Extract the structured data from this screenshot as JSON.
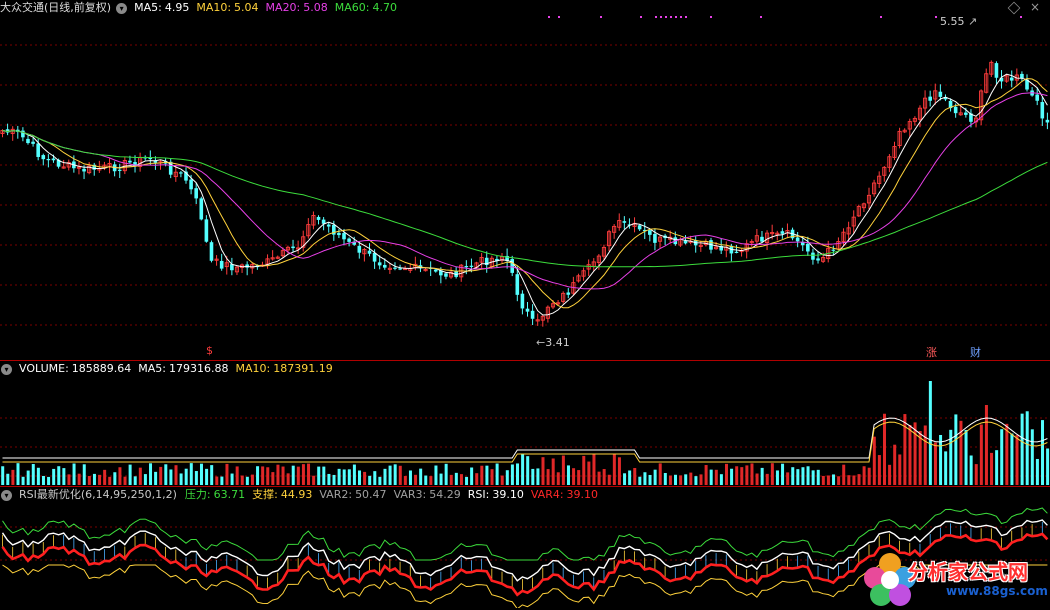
{
  "main_panel": {
    "title": "大众交通(日线,前复权)",
    "indicators": [
      {
        "label": "MA5:",
        "value": "4.95",
        "color": "#ffffff"
      },
      {
        "label": "MA10:",
        "value": "5.04",
        "color": "#ffd23c"
      },
      {
        "label": "MA20:",
        "value": "5.08",
        "color": "#e640e6"
      },
      {
        "label": "MA60:",
        "value": "4.70",
        "color": "#3cdc3c"
      }
    ],
    "high_label": "5.55",
    "low_label": "3.41",
    "markers": [
      {
        "text": "$",
        "color": "#ff3c3c"
      },
      {
        "text": "涨",
        "color": "#ff5a5a"
      },
      {
        "text": "财",
        "color": "#6ea0ff"
      }
    ],
    "corner_icons": [
      "settings-diamond-icon",
      "close-x-icon"
    ]
  },
  "volume_panel": {
    "indicators": [
      {
        "label": "VOLUME:",
        "value": "185889.64",
        "color": "#ffffff"
      },
      {
        "label": "MA5:",
        "value": "179316.88",
        "color": "#ffffff"
      },
      {
        "label": "MA10:",
        "value": "187391.19",
        "color": "#ffd23c"
      }
    ]
  },
  "rsi_panel": {
    "name": "RSI最新优化(6,14,95,250,1,2)",
    "indicators": [
      {
        "label": "压力:",
        "value": "63.71",
        "color": "#3cdc3c"
      },
      {
        "label": "支撑:",
        "value": "44.93",
        "color": "#ffd23c"
      },
      {
        "label": "VAR2:",
        "value": "50.47",
        "color": "#a0a0a0"
      },
      {
        "label": "VAR3:",
        "value": "54.29",
        "color": "#a0a0a0"
      },
      {
        "label": "RSI:",
        "value": "39.10",
        "color": "#ffffff"
      },
      {
        "label": "VAR4:",
        "value": "39.10",
        "color": "#ff2828"
      }
    ]
  },
  "watermark": {
    "text": "分析家公式网",
    "url": "www.88gs.com"
  },
  "colors": {
    "up": "#ff3c3c",
    "down": "#54ffff",
    "grid": "#7a0000",
    "background": "#000000"
  }
}
